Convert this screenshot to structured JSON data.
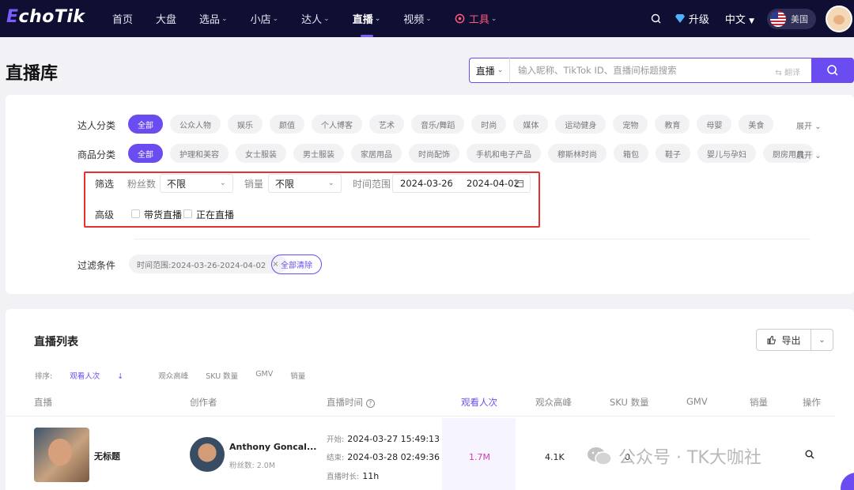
{
  "brand": {
    "logo_e": "E",
    "logo_rest": "choTik"
  },
  "nav": {
    "items": [
      {
        "label": "首页",
        "caret": ""
      },
      {
        "label": "大盘",
        "caret": ""
      },
      {
        "label": "选品",
        "caret": "⌄"
      },
      {
        "label": "小店",
        "caret": "⌄"
      },
      {
        "label": "达人",
        "caret": "⌄"
      },
      {
        "label": "直播",
        "caret": "⌄"
      },
      {
        "label": "视频",
        "caret": "⌄"
      },
      {
        "label": "工具",
        "caret": "⌄"
      }
    ],
    "active": "直播",
    "upgrade": "升级",
    "language": "中文",
    "country": "美国",
    "icons": {
      "search": "search-icon",
      "upgrade": "diamond-icon",
      "tools": "tool-icon"
    }
  },
  "page": {
    "title": "直播库"
  },
  "search": {
    "type": "直播",
    "placeholder": "输入昵称、TikTok ID、直播间标题搜索",
    "translate": "翻译"
  },
  "filters": {
    "creator_label": "达人分类",
    "creator_chips": [
      "全部",
      "公众人物",
      "娱乐",
      "颜值",
      "个人博客",
      "艺术",
      "音乐/舞蹈",
      "时尚",
      "媒体",
      "运动健身",
      "宠物",
      "教育",
      "母婴",
      "美食"
    ],
    "product_label": "商品分类",
    "product_chips": [
      "全部",
      "护理和美容",
      "女士服装",
      "男士服装",
      "家居用品",
      "时尚配饰",
      "手机和电子产品",
      "穆斯林时尚",
      "箱包",
      "鞋子",
      "婴儿与孕妇",
      "厨房用具"
    ],
    "expand": "展开",
    "screen_label": "筛选",
    "fans_label": "粉丝数",
    "fans_value": "不限",
    "sales_label": "销量",
    "sales_value": "不限",
    "time_label": "时间范围",
    "date_start": "2024-03-26",
    "date_sep": "-",
    "date_end": "2024-04-02",
    "advanced_label": "高级",
    "cb_goods": "带货直播",
    "cb_live": "正在直播",
    "applied_label": "过滤条件",
    "applied_tag": "时间范围:2024-03-26-2024-04-02",
    "clear_all": "全部清除"
  },
  "list": {
    "title": "直播列表",
    "export": "导出",
    "sort_label": "排序:",
    "sort_options": [
      "观看人次",
      "观众高峰",
      "SKU 数量",
      "GMV",
      "销量"
    ],
    "sort_active": "观看人次",
    "columns": [
      "直播",
      "创作者",
      "直播时间",
      "观看人次",
      "观众高峰",
      "SKU 数量",
      "GMV",
      "销量",
      "操作"
    ],
    "rows": [
      {
        "title": "无标题",
        "creator": "Anthony Goncal...",
        "fans": "粉丝数: 2.0M",
        "start_k": "开始:",
        "start": "2024-03-27 15:49:13",
        "end_k": "结束:",
        "end": "2024-03-28 02:49:36",
        "dur_k": "直播时长:",
        "duration": "11h",
        "views": "1.7M",
        "peak": "4.1K",
        "sku": "0"
      }
    ]
  },
  "watermark": "公众号 · TK大咖社",
  "colors": {
    "accent": "#6b4cf0",
    "nav_bg": "#0f0e33",
    "highlight": "#e23232",
    "tool": "#ff5a78",
    "views": "#d63bb3"
  }
}
